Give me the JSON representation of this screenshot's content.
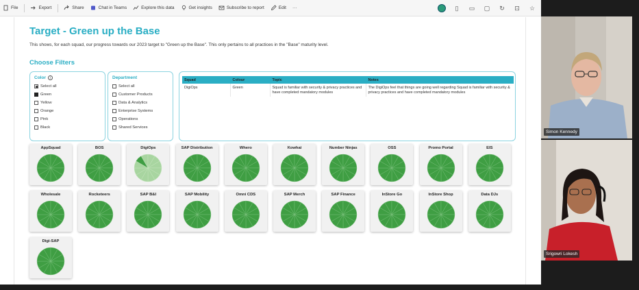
{
  "toolbar": {
    "items": [
      {
        "label": "File",
        "icon": "file-icon"
      },
      {
        "label": "Export",
        "icon": "export-icon"
      },
      {
        "label": "Share",
        "icon": "share-icon"
      },
      {
        "label": "Chat in Teams",
        "icon": "teams-icon"
      },
      {
        "label": "Explore this data",
        "icon": "explore-icon"
      },
      {
        "label": "Get insights",
        "icon": "lightbulb-icon"
      },
      {
        "label": "Subscribe to report",
        "icon": "subscribe-icon"
      },
      {
        "label": "Edit",
        "icon": "pencil-icon"
      },
      {
        "label": "···",
        "icon": "more-icon"
      }
    ]
  },
  "report": {
    "title": "Target - Green up the Base",
    "description": "This shows, for each squad, our progress towards our 2023 target to \"Green up the Base\". This only pertains to all practices in the \"Base\" maturity level.",
    "filters_title": "Choose Filters"
  },
  "color_slicer": {
    "title": "Color",
    "items": [
      {
        "label": "Select all",
        "state": "partial"
      },
      {
        "label": "Green",
        "state": "checked"
      },
      {
        "label": "Yellow",
        "state": "unchecked"
      },
      {
        "label": "Orange",
        "state": "unchecked"
      },
      {
        "label": "Pink",
        "state": "unchecked"
      },
      {
        "label": "Black",
        "state": "unchecked"
      }
    ]
  },
  "dept_slicer": {
    "title": "Department",
    "items": [
      {
        "label": "Select all",
        "state": "unchecked"
      },
      {
        "label": "Customer Products",
        "state": "unchecked"
      },
      {
        "label": "Data & Analytics",
        "state": "unchecked"
      },
      {
        "label": "Enterprise Systems",
        "state": "unchecked"
      },
      {
        "label": "Operations",
        "state": "unchecked"
      },
      {
        "label": "Shared Services",
        "state": "unchecked"
      }
    ]
  },
  "table": {
    "headers": [
      "Squad",
      "Colour",
      "Topic",
      "Notes"
    ],
    "rows": [
      [
        "DigiOps",
        "Green",
        "Squad is familiar with security & privacy practices and have completed mandatory modules",
        "The DigiOps feel that things are going well regarding Squad is familiar with security & privacy practices and have completed mandatory modules"
      ]
    ]
  },
  "squads": [
    {
      "name": "AppSquad",
      "green_fraction": 1
    },
    {
      "name": "BOS",
      "green_fraction": 1
    },
    {
      "name": "DigiOps",
      "green_fraction": 0.1
    },
    {
      "name": "SAP Distribution",
      "green_fraction": 1
    },
    {
      "name": "Whero",
      "green_fraction": 1
    },
    {
      "name": "Kowhai",
      "green_fraction": 1
    },
    {
      "name": "Number Ninjas",
      "green_fraction": 1
    },
    {
      "name": "OSS",
      "green_fraction": 1
    },
    {
      "name": "Promo Portal",
      "green_fraction": 1
    },
    {
      "name": "EIS",
      "green_fraction": 1
    },
    {
      "name": "Wholesale",
      "green_fraction": 1
    },
    {
      "name": "Rocketeers",
      "green_fraction": 1
    },
    {
      "name": "SAP B&I",
      "green_fraction": 1
    },
    {
      "name": "SAP Mobility",
      "green_fraction": 1
    },
    {
      "name": "Omni CDS",
      "green_fraction": 1
    },
    {
      "name": "SAP Merch",
      "green_fraction": 1
    },
    {
      "name": "SAP Finance",
      "green_fraction": 1
    },
    {
      "name": "InStore Go",
      "green_fraction": 1
    },
    {
      "name": "InStore Shop",
      "green_fraction": 1
    },
    {
      "name": "Data DJs",
      "green_fraction": 1
    },
    {
      "name": "Digi-SAP",
      "green_fraction": 1
    }
  ],
  "colors": {
    "accent": "#2aaec4",
    "pie_green": "#3f9e43",
    "pie_light": "#a8d5a0"
  },
  "participants": [
    {
      "name": "Simon Kennedy"
    },
    {
      "name": "Srigowri Lokesh"
    }
  ]
}
